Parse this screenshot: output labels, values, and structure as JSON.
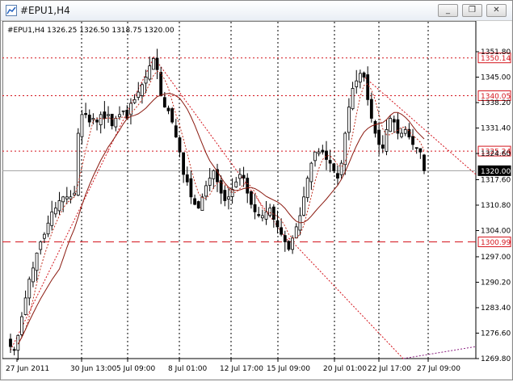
{
  "window": {
    "title": "#EPU1,H4",
    "buttons": {
      "minimize": "_",
      "restore": "❐",
      "close": "✕"
    }
  },
  "chart_info": {
    "symbol_line": "#EPU1,H4  1326.25 1326.50 1318.75 1320.00"
  },
  "price_labels": [
    "1351.80",
    "1345.00",
    "1338.20",
    "1331.40",
    "1324.60",
    "1317.60",
    "1310.80",
    "1304.00",
    "1297.00",
    "1290.20",
    "1283.40",
    "1276.60",
    "1269.80"
  ],
  "time_labels": [
    "27 Jun 2011",
    "30 Jun 13:00",
    "5 Jul 09:00",
    "8 Jul 01:00",
    "12 Jul 17:00",
    "15 Jul 09:00",
    "20 Jul 01:00",
    "22 Jul 17:00",
    "27 Jul 09:00"
  ],
  "levels": [
    {
      "value": 1350.14,
      "label": "1350.14",
      "color": "#d4141c",
      "style": "dotted"
    },
    {
      "value": 1340.05,
      "label": "1340.05",
      "color": "#d4141c",
      "style": "dotted"
    },
    {
      "value": 1325.24,
      "label": "1325.24",
      "color": "#d4141c",
      "style": "dotted"
    },
    {
      "value": 1300.99,
      "label": "1300.99",
      "color": "#d4141c",
      "style": "dashed"
    },
    {
      "value": 1320.0,
      "label": "1320.00",
      "color": "#000000",
      "style": "solid"
    }
  ],
  "colors": {
    "candle": "#000000",
    "ma_fast": "#c03020",
    "ma_slow": "#8b1a10",
    "level": "#d4141c"
  },
  "chart_data": {
    "type": "candlestick",
    "timeframe": "H4",
    "symbol": "#EPU1",
    "last": {
      "open": 1326.25,
      "high": 1326.5,
      "low": 1318.75,
      "close": 1320.0
    },
    "ylim": [
      1269.8,
      1351.8
    ],
    "series_close": [
      1273,
      1272,
      1276,
      1281,
      1286,
      1291,
      1294,
      1298,
      1301,
      1303,
      1306,
      1309,
      1310,
      1312,
      1313,
      1313,
      1313,
      1314,
      1330,
      1335,
      1335,
      1333,
      1334,
      1333,
      1335,
      1334,
      1335,
      1332,
      1334,
      1335,
      1336,
      1334,
      1338,
      1339,
      1341,
      1343,
      1345,
      1348,
      1350,
      1347,
      1340,
      1337,
      1336,
      1333,
      1329,
      1325,
      1319,
      1317,
      1313,
      1311,
      1310,
      1313,
      1316,
      1318,
      1320,
      1317,
      1314,
      1312,
      1313,
      1315,
      1317,
      1319,
      1318,
      1314,
      1311,
      1309,
      1308,
      1308,
      1309,
      1310,
      1307,
      1305,
      1303,
      1301,
      1299,
      1302,
      1305,
      1308,
      1313,
      1318,
      1322,
      1325,
      1325,
      1325,
      1323,
      1322,
      1320,
      1318,
      1322,
      1330,
      1337,
      1342,
      1344,
      1346,
      1345,
      1339,
      1334,
      1330,
      1327,
      1326,
      1331,
      1334,
      1333,
      1330,
      1330,
      1331,
      1329,
      1327,
      1326,
      1325,
      1320
    ]
  }
}
